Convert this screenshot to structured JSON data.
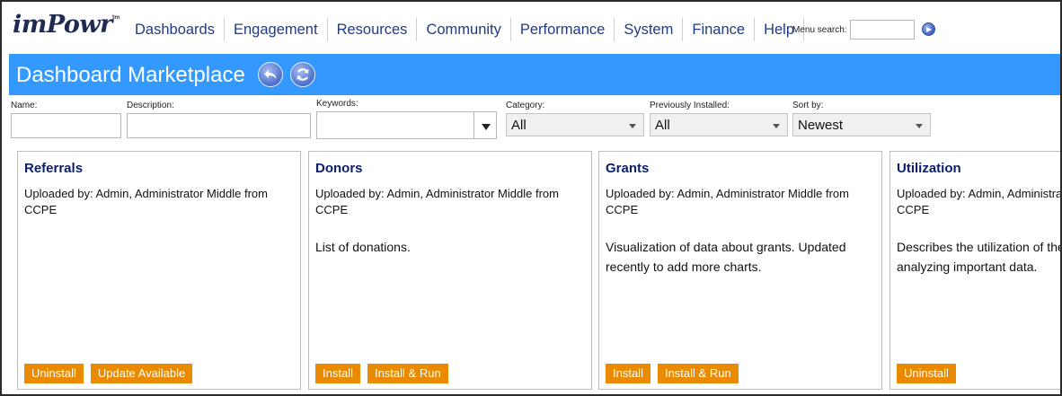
{
  "app": {
    "logo_text": "imPowr",
    "logo_tm": "tm"
  },
  "nav": {
    "items": [
      {
        "label": "Dashboards"
      },
      {
        "label": "Engagement"
      },
      {
        "label": "Resources"
      },
      {
        "label": "Community"
      },
      {
        "label": "Performance"
      },
      {
        "label": "System"
      },
      {
        "label": "Finance"
      },
      {
        "label": "Help"
      }
    ],
    "search_label": "Menu search:",
    "search_value": ""
  },
  "page": {
    "title": "Dashboard Marketplace"
  },
  "filters": {
    "name_label": "Name:",
    "name_value": "",
    "description_label": "Description:",
    "description_value": "",
    "keywords_label": "Keywords:",
    "keywords_value": "",
    "category_label": "Category:",
    "category_value": "All",
    "installed_label": "Previously Installed:",
    "installed_value": "All",
    "sort_label": "Sort by:",
    "sort_value": "Newest"
  },
  "cards": [
    {
      "title": "Referrals",
      "uploader": "Uploaded by: Admin, Administrator Middle from CCPE",
      "description": "",
      "actions": [
        "Uninstall",
        "Update Available"
      ]
    },
    {
      "title": "Donors",
      "uploader": "Uploaded by: Admin, Administrator Middle from CCPE",
      "description": "List of donations.",
      "actions": [
        "Install",
        "Install & Run"
      ]
    },
    {
      "title": "Grants",
      "uploader": "Uploaded by: Admin, Administrator Middle from CCPE",
      "description": "Visualization of data about grants. Updated recently to add more charts.",
      "actions": [
        "Install",
        "Install & Run"
      ]
    },
    {
      "title": "Utilization",
      "uploader": "Uploaded by: Admin, Administrator Middle from CCPE",
      "description": "Describes the utilization of the Provides tools for analyzing important data.",
      "actions": [
        "Uninstall"
      ]
    }
  ],
  "colors": {
    "accent_bar": "#3399ff",
    "button": "#e98a00",
    "nav_link": "#1f3a88",
    "card_title": "#0b1f6b"
  }
}
